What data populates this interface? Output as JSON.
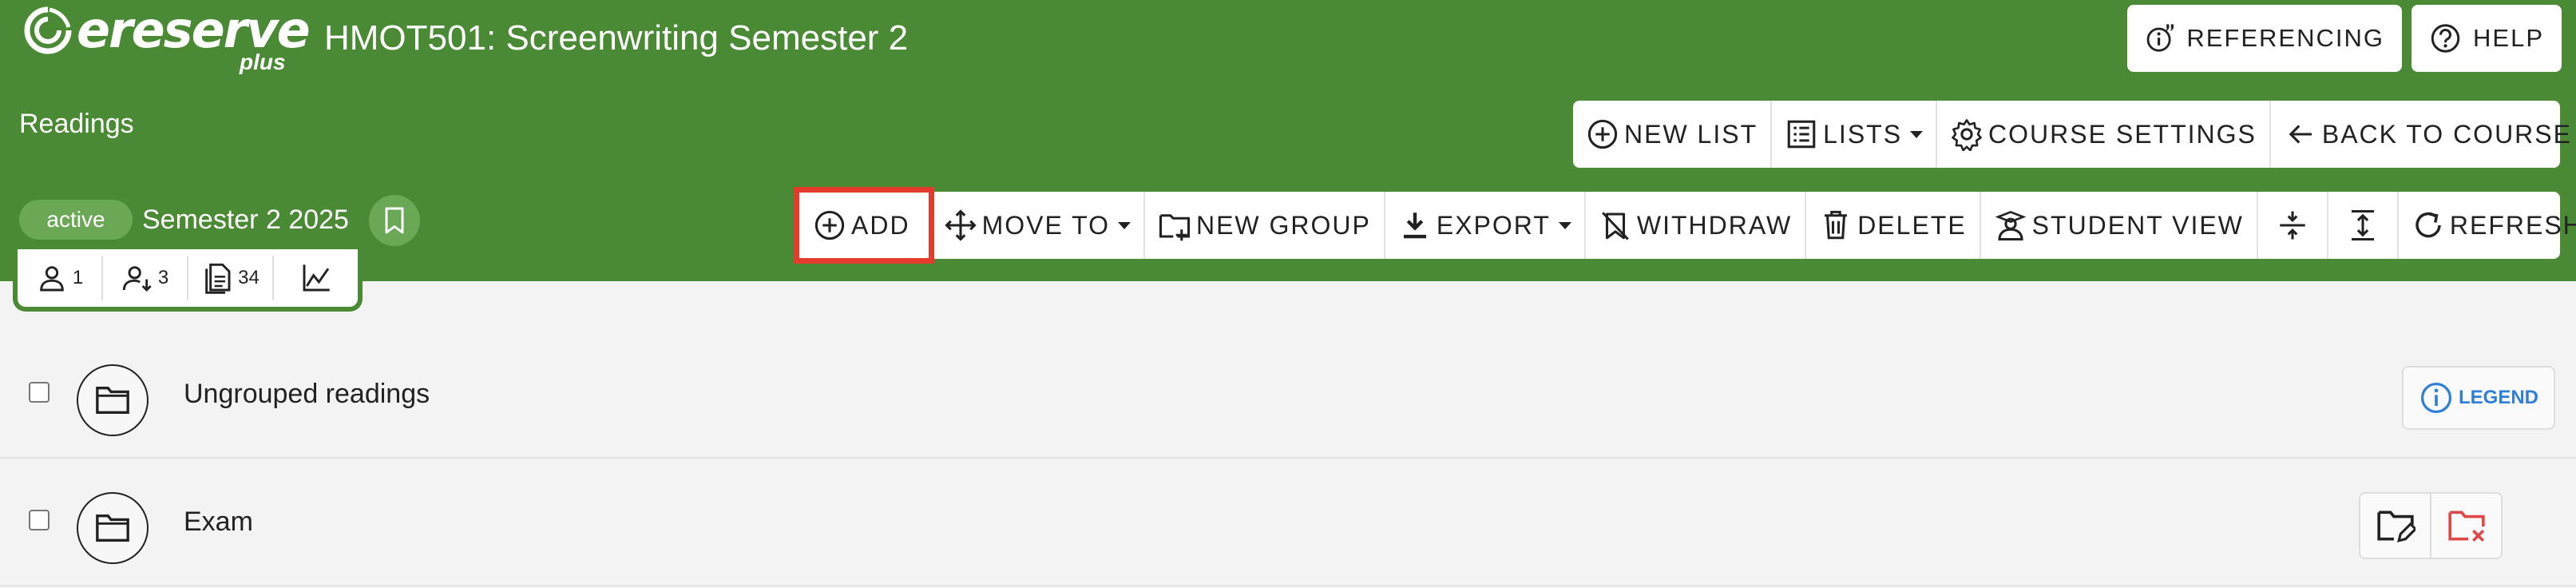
{
  "header": {
    "logo_text": "ereserve",
    "logo_suffix": "plus",
    "course_title": "HMOT501: Screenwriting Semester 2",
    "section_label": "Readings",
    "referencing_label": "REFERENCING",
    "help_label": "HELP"
  },
  "list_toolbar": {
    "new_list": "NEW LIST",
    "lists": "LISTS",
    "course_settings": "COURSE SETTINGS",
    "back_to_course": "BACK TO COURSE"
  },
  "status": {
    "badge": "active",
    "semester": "Semester 2 2025"
  },
  "stats": {
    "users": "1",
    "subscribers": "3",
    "readings": "34"
  },
  "action_toolbar": {
    "add": "ADD",
    "move_to": "MOVE TO",
    "new_group": "NEW GROUP",
    "export": "EXPORT",
    "withdraw": "WITHDRAW",
    "delete": "DELETE",
    "student_view": "STUDENT VIEW",
    "refresh": "REFRESH"
  },
  "groups": [
    {
      "title": "Ungrouped readings",
      "action_label": "LEGEND"
    },
    {
      "title": "Exam"
    }
  ],
  "colors": {
    "header_green": "#4a8a34",
    "badge_green": "#6aa856",
    "highlight_red": "#e53b2c",
    "legend_blue": "#2f7fd8",
    "delete_red": "#e04848"
  }
}
